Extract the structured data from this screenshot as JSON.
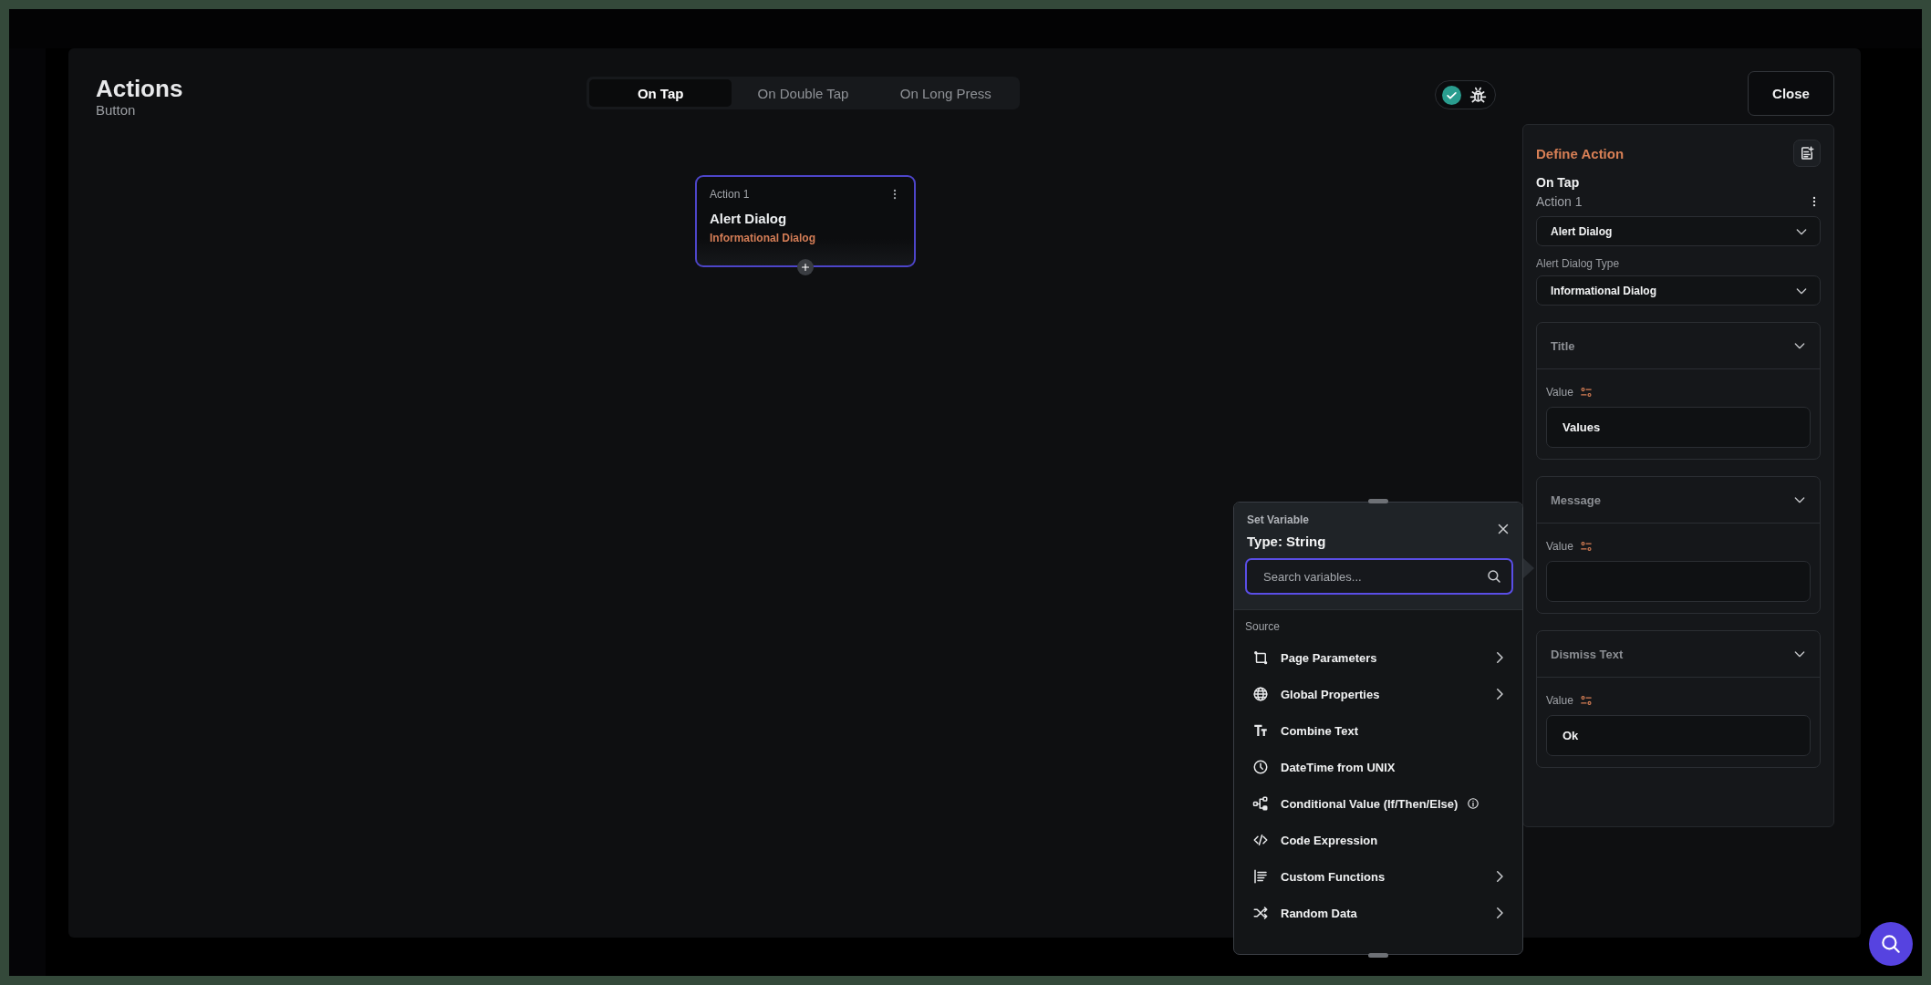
{
  "modal": {
    "title": "Actions",
    "subtitle": "Button",
    "close": "Close"
  },
  "tabs": [
    {
      "label": "On Tap",
      "selected": true
    },
    {
      "label": "On Double Tap",
      "selected": false
    },
    {
      "label": "On Long Press",
      "selected": false
    }
  ],
  "status": {
    "valid": true
  },
  "action_node": {
    "label": "Action 1",
    "title": "Alert Dialog",
    "subtitle": "Informational Dialog",
    "selected": true
  },
  "define_action": {
    "heading": "Define Action",
    "trigger": "On Tap",
    "action_label": "Action 1",
    "action_type": "Alert Dialog",
    "dialog_type_label": "Alert Dialog Type",
    "dialog_type": "Informational Dialog",
    "sections": [
      {
        "title": "Title",
        "expanded": true,
        "value_label": "Value",
        "value": "Values"
      },
      {
        "title": "Message",
        "expanded": true,
        "value_label": "Value"
      },
      {
        "title": "Dismiss Text",
        "expanded": true,
        "value_label": "Value",
        "value": "Ok"
      }
    ]
  },
  "set_variable": {
    "heading": "Set Variable",
    "type": "Type: String",
    "search_placeholder": "Search variables...",
    "source_label": "Source",
    "items": [
      {
        "kind": "page_parameters",
        "label": "Page Parameters",
        "submenu": true,
        "info": false
      },
      {
        "kind": "global_properties",
        "label": "Global Properties",
        "submenu": true,
        "info": false
      },
      {
        "kind": "combine_text",
        "label": "Combine Text",
        "submenu": false,
        "info": false
      },
      {
        "kind": "datetime",
        "label": "DateTime from UNIX",
        "submenu": false,
        "info": false
      },
      {
        "kind": "conditional",
        "label": "Conditional Value (If/Then/Else)",
        "submenu": false,
        "info": true
      },
      {
        "kind": "code",
        "label": "Code Expression",
        "submenu": false,
        "info": false
      },
      {
        "kind": "functions",
        "label": "Custom Functions",
        "submenu": true,
        "info": false
      },
      {
        "kind": "random",
        "label": "Random Data",
        "submenu": true,
        "info": false
      }
    ]
  }
}
